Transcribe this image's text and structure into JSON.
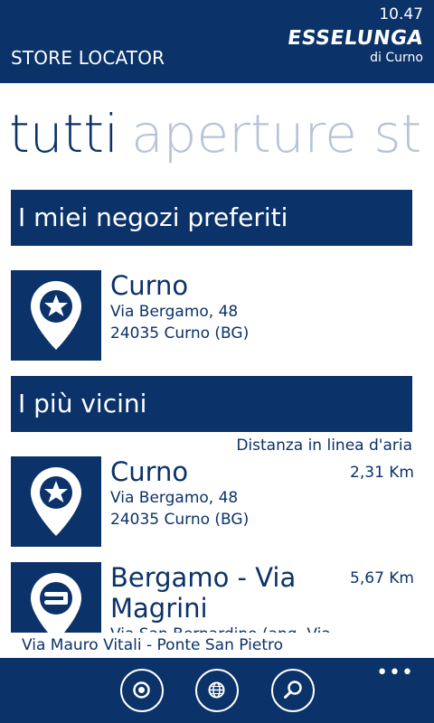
{
  "status_bar": {
    "time": "10.47"
  },
  "header": {
    "title": "STORE LOCATOR",
    "brand": "ESSELUNGA",
    "brand_location": "di Curno"
  },
  "pivot": {
    "active": "tutti",
    "next": "aperture st"
  },
  "favorites": {
    "header": "I miei negozi preferiti",
    "items": [
      {
        "name": "Curno",
        "address": "Via Bergamo, 48",
        "city": "24035 Curno (BG)",
        "icon": "star-pin-icon"
      }
    ]
  },
  "nearby": {
    "header": "I più vicini",
    "distance_note": "Distanza in linea d'aria",
    "items": [
      {
        "name": "Curno",
        "address": "Via Bergamo, 48",
        "city": "24035 Curno (BG)",
        "distance": "2,31 Km",
        "icon": "star-pin-icon"
      },
      {
        "name_line1": "Bergamo - Via",
        "name_line2": "Magrini",
        "address": "Via San Bernardino (ang. Via",
        "distance": "5,67 Km",
        "icon": "s-pin-icon"
      }
    ]
  },
  "ticker": "Via Mauro Vitali - Ponte San Pietro",
  "appbar": {
    "buttons": [
      "location-icon",
      "globe-icon",
      "search-icon"
    ],
    "more": "•••"
  },
  "colors": {
    "primary": "#0b3269",
    "inactive_pivot": "#b7c3d6",
    "background": "#ffffff"
  }
}
